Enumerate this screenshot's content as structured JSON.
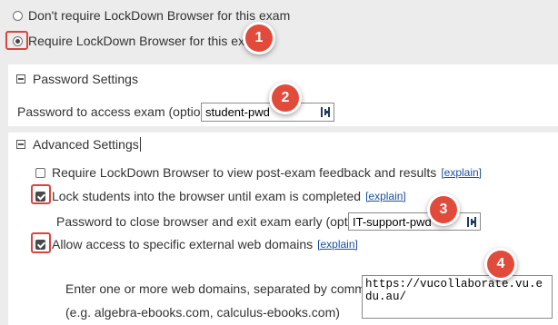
{
  "options": {
    "dont_require": "Don't require LockDown Browser for this exam",
    "require": "Require LockDown Browser for this exam"
  },
  "password_settings": {
    "title": "Password Settings",
    "label": "Password to access exam (optional)",
    "value": "student-pwd"
  },
  "advanced_settings": {
    "title": "Advanced Settings",
    "feedback_label": "Require LockDown Browser to view post-exam feedback and results",
    "explain_link": "[explain]",
    "lock_label": "Lock students into the browser until exam is completed",
    "close_password_label": "Password to close browser and exit exam early (optional)",
    "close_password_value": "IT-support-pwd",
    "allow_label": "Allow access to specific external web domains",
    "domains_instruction": "Enter one or more web domains, separated by commas",
    "domains_example": "(e.g. algebra-ebooks.com, calculus-ebooks.com)",
    "domains_value": "https://vucollaborate.vu.edu.au/"
  },
  "badges": [
    "1",
    "2",
    "3",
    "4"
  ],
  "colors": {
    "badge": "#e14b3c",
    "highlight": "#d9443d",
    "link": "#1a4f9c",
    "background": "#ececec"
  }
}
